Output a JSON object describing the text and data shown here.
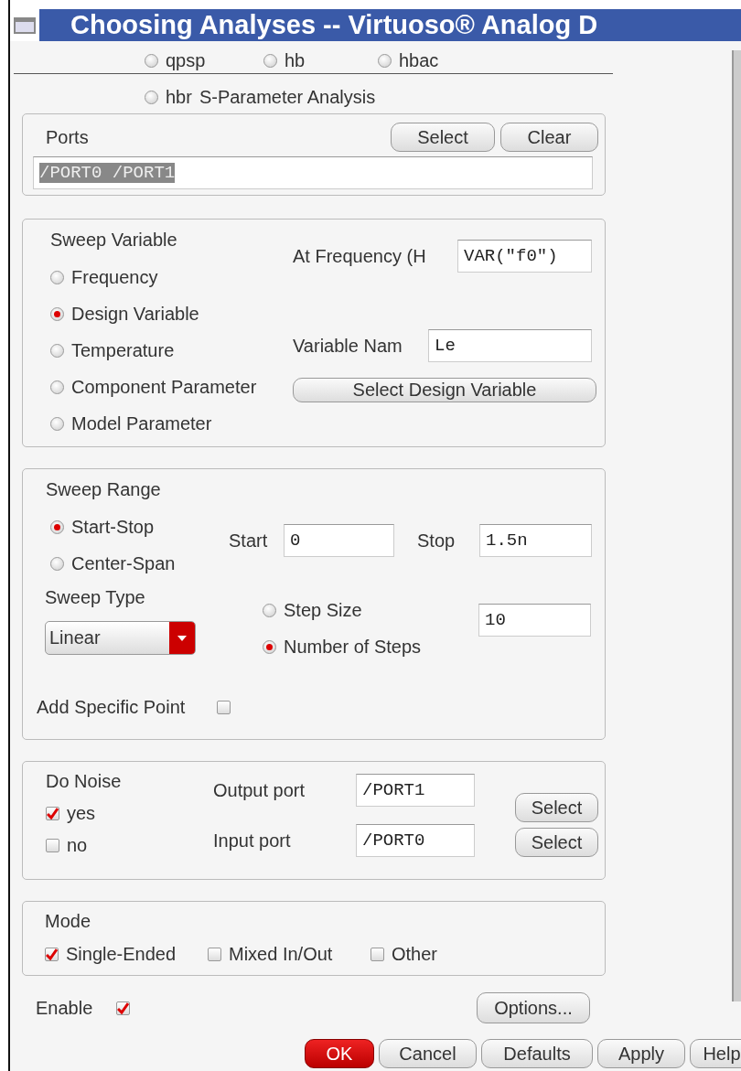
{
  "window": {
    "title": "Choosing Analyses -- Virtuoso® Analog D"
  },
  "analyses": [
    {
      "label": "qpsp",
      "selected": false
    },
    {
      "label": "hb",
      "selected": false
    },
    {
      "label": "hbac",
      "selected": false
    }
  ],
  "analysis_row2": {
    "label": "hbr",
    "selected": false
  },
  "section_title": "S-Parameter Analysis",
  "ports": {
    "label": "Ports",
    "select_button": "Select",
    "clear_button": "Clear",
    "value": "/PORT0 /PORT1",
    "text_selected": true
  },
  "sweep_variable": {
    "title": "Sweep Variable",
    "options": [
      {
        "label": "Frequency",
        "selected": false
      },
      {
        "label": "Design Variable",
        "selected": true
      },
      {
        "label": "Temperature",
        "selected": false
      },
      {
        "label": "Component Parameter",
        "selected": false
      },
      {
        "label": "Model Parameter",
        "selected": false
      }
    ],
    "at_frequency": {
      "label": "At Frequency (H",
      "value": "VAR(\"f0\")"
    },
    "variable_name": {
      "label": "Variable Nam",
      "value": "Le"
    },
    "select_button": "Select Design Variable"
  },
  "sweep_range": {
    "title": "Sweep Range",
    "options": [
      {
        "label": "Start-Stop",
        "selected": true
      },
      {
        "label": "Center-Span",
        "selected": false
      }
    ],
    "start": {
      "label": "Start",
      "value": "0"
    },
    "stop": {
      "label": "Stop",
      "value": "1.5n"
    },
    "sweep_type": {
      "label": "Sweep Type",
      "value": "Linear"
    },
    "step_options": [
      {
        "label": "Step Size",
        "selected": false
      },
      {
        "label": "Number of Steps",
        "selected": true
      }
    ],
    "steps_value": "10",
    "add_specific_points": {
      "label": "Add Specific Point",
      "checked": false
    }
  },
  "noise": {
    "title": "Do Noise",
    "options": [
      {
        "label": "yes",
        "checked": true
      },
      {
        "label": "no",
        "checked": false
      }
    ],
    "ports": [
      {
        "label": "Output port",
        "value": "/PORT1",
        "button": "Select"
      },
      {
        "label": "Input port",
        "value": "/PORT0",
        "button": "Select"
      }
    ]
  },
  "mode": {
    "title": "Mode",
    "options": [
      {
        "label": "Single-Ended",
        "checked": true
      },
      {
        "label": "Mixed In/Out",
        "checked": false
      },
      {
        "label": "Other",
        "checked": false
      }
    ]
  },
  "enabled": {
    "label": "Enable",
    "checked": true
  },
  "options_button": "Options...",
  "footer_buttons": [
    {
      "label": "OK",
      "kind": "primary"
    },
    {
      "label": "Cancel",
      "kind": "normal"
    },
    {
      "label": "Defaults",
      "kind": "normal"
    },
    {
      "label": "Apply",
      "kind": "normal"
    },
    {
      "label": "Help",
      "kind": "normal"
    }
  ]
}
